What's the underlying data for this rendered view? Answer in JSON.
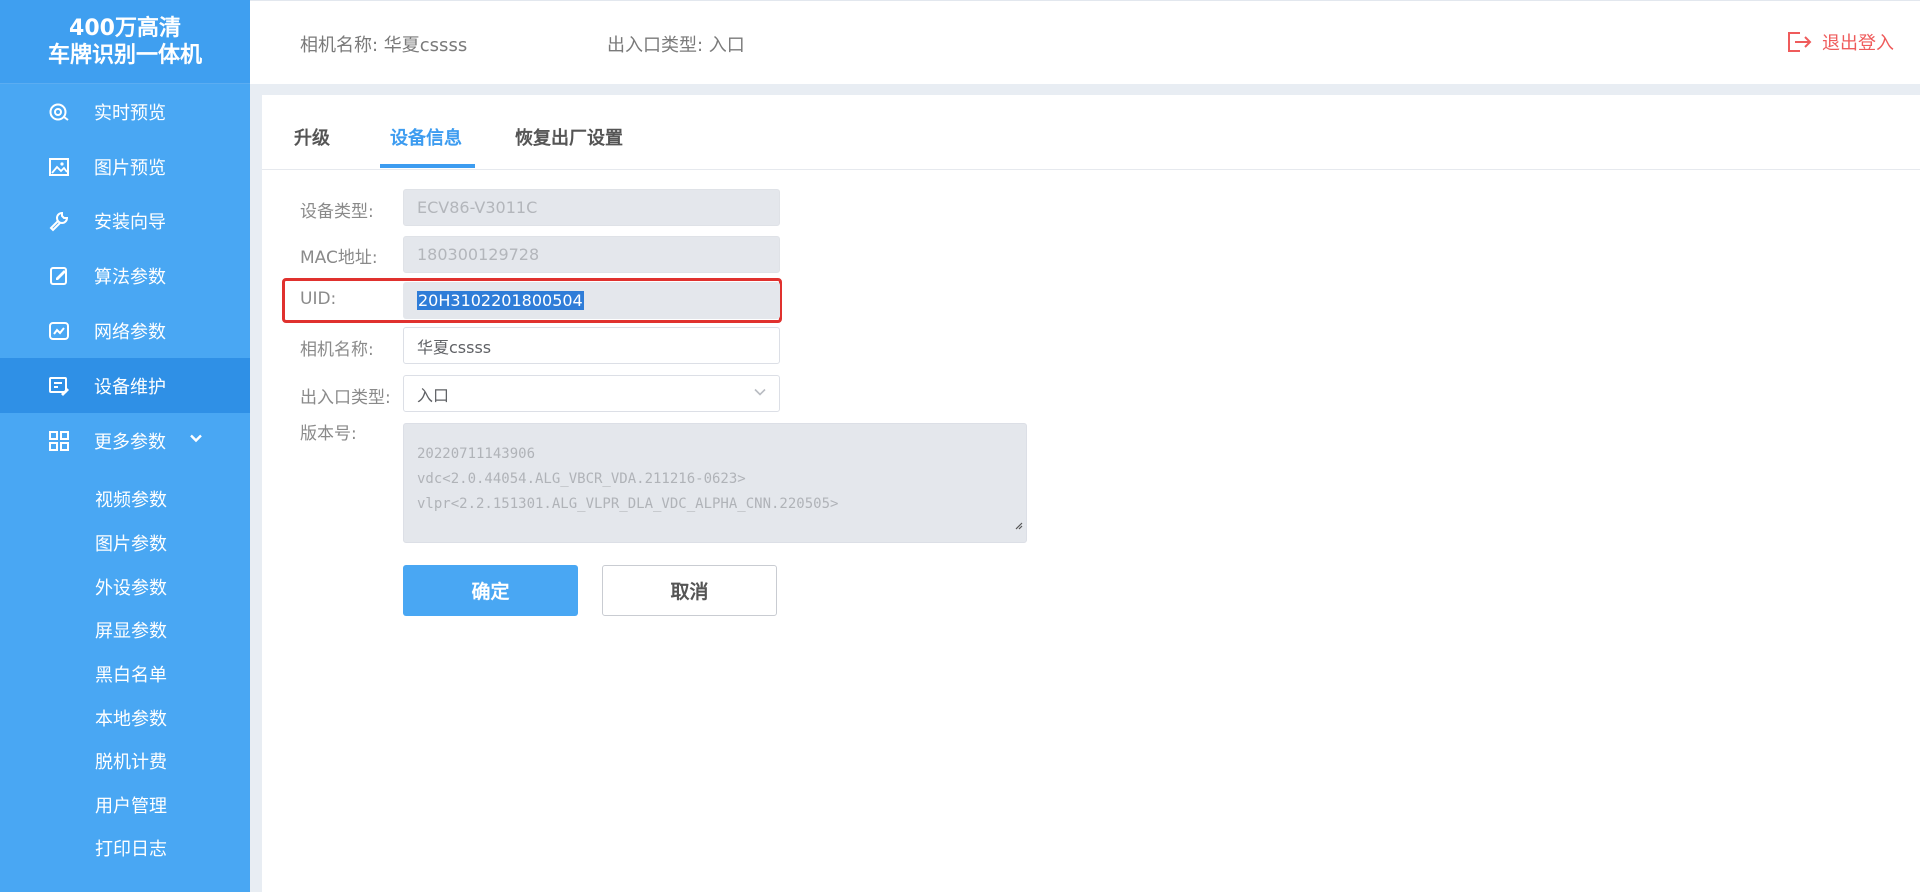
{
  "brand": {
    "line1": "400万高清",
    "line2": "车牌识别一体机"
  },
  "sidebar": {
    "items": [
      {
        "label": "实时预览",
        "icon": "live-preview-icon"
      },
      {
        "label": "图片预览",
        "icon": "image-icon"
      },
      {
        "label": "安装向导",
        "icon": "wrench-icon"
      },
      {
        "label": "算法参数",
        "icon": "edit-icon"
      },
      {
        "label": "网络参数",
        "icon": "chart-icon"
      },
      {
        "label": "设备维护",
        "icon": "maintenance-icon",
        "active": true
      },
      {
        "label": "更多参数",
        "icon": "grid-icon",
        "expanded": true
      }
    ],
    "sub_items": [
      "视频参数",
      "图片参数",
      "外设参数",
      "屏显参数",
      "黑白名单",
      "本地参数",
      "脱机计费",
      "用户管理",
      "打印日志"
    ]
  },
  "header": {
    "camera_name": "相机名称: 华夏cssss",
    "entry_type": "出入口类型: 入口",
    "logout": "退出登入"
  },
  "tabs": [
    {
      "label": "升级"
    },
    {
      "label": "设备信息",
      "active": true
    },
    {
      "label": "恢复出厂设置"
    }
  ],
  "form": {
    "device_type": {
      "label": "设备类型:",
      "value": "ECV86-V3011C"
    },
    "mac": {
      "label": "MAC地址:",
      "value": "180300129728"
    },
    "uid": {
      "label": "UID:",
      "value": "20H3102201800504"
    },
    "camera_name": {
      "label": "相机名称:",
      "value": "华夏cssss"
    },
    "entry_type": {
      "label": "出入口类型:",
      "value": "入口"
    },
    "version": {
      "label": "版本号:",
      "lines": [
        "20220711143906",
        "vdc<2.0.44054.ALG_VBCR_VDA.211216-0623>",
        "vlpr<2.2.151301.ALG_VLPR_DLA_VDC_ALPHA_CNN.220505>"
      ]
    },
    "confirm": "确定",
    "cancel": "取消"
  },
  "colors": {
    "sidebar": "#49a7f3",
    "active_nav": "#2f90e6",
    "accent": "#3d9cf0",
    "highlight": "#e0312e",
    "logout": "#ef5b5b"
  }
}
